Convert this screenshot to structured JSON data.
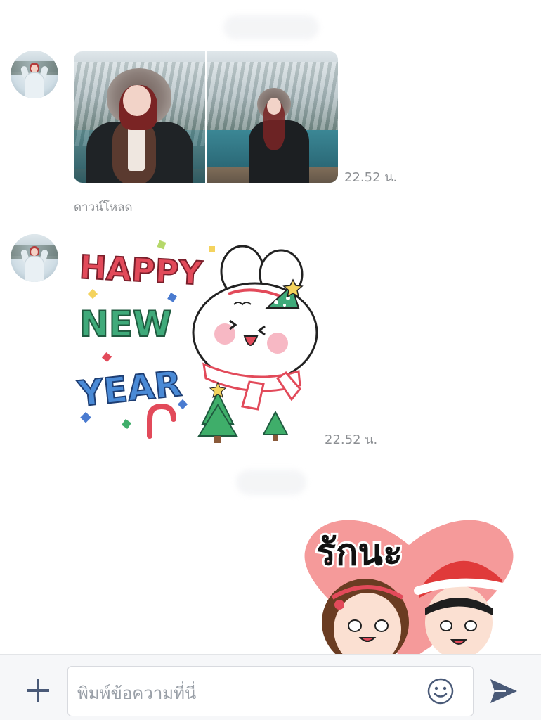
{
  "messages": [
    {
      "type": "photos",
      "sender": "contact",
      "photo_count": 2,
      "time": "22.52 น.",
      "download_label": "ดาวน์โหลด"
    },
    {
      "type": "sticker",
      "sender": "contact",
      "sticker_text": [
        "HAPPY",
        "NEW",
        "YEAR"
      ],
      "time": "22.52 น."
    },
    {
      "type": "sticker",
      "sender": "me",
      "sticker_text": [
        "รักนะ"
      ]
    }
  ],
  "composer": {
    "placeholder": "พิมพ์ข้อความที่นี่",
    "add_icon": "plus-icon",
    "emoji_icon": "smiley-icon",
    "send_icon": "send-icon"
  },
  "colors": {
    "background": "#ffffff",
    "timestamp": "#8c8f93",
    "composer_bg": "#f6f7f9",
    "icon": "#4a5a78"
  }
}
